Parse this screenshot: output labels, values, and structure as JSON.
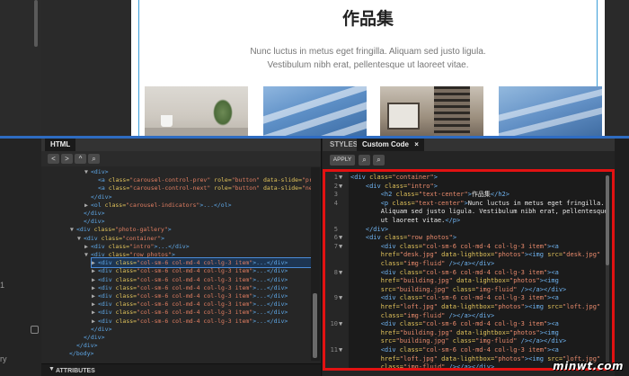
{
  "preview": {
    "title": "作品集",
    "intro_line1": "Nunc luctus in metus eget fringilla. Aliquam sed justo ligula.",
    "intro_line2": "Vestibulum nibh erat, pellentesque ut laoreet vitae."
  },
  "gutter": {
    "tick1": "1",
    "tick2": "ry"
  },
  "html_panel": {
    "tab": "HTML",
    "toolbar": [
      "<",
      ">",
      "^",
      "search-icon"
    ],
    "tree": [
      {
        "indent": 1,
        "tri": "▼",
        "parts": [
          [
            "tag",
            "<div>"
          ]
        ]
      },
      {
        "indent": 2,
        "tri": "",
        "parts": [
          [
            "tag",
            "<a "
          ],
          [
            "attr",
            "class="
          ],
          [
            "str",
            "\"carousel-control-prev\""
          ],
          [
            "attr",
            " role="
          ],
          [
            "str",
            "\"button\""
          ],
          [
            "attr",
            " data-slide="
          ],
          [
            "str",
            "\"prev\""
          ],
          [
            "attr",
            " href="
          ],
          [
            "str",
            "\"#carouse"
          ]
        ]
      },
      {
        "indent": 2,
        "tri": "",
        "parts": [
          [
            "tag",
            "<a "
          ],
          [
            "attr",
            "class="
          ],
          [
            "str",
            "\"carousel-control-next\""
          ],
          [
            "attr",
            " role="
          ],
          [
            "str",
            "\"button\""
          ],
          [
            "attr",
            " data-slide="
          ],
          [
            "str",
            "\"next\""
          ],
          [
            "attr",
            " href="
          ],
          [
            "str",
            "\"#carouse"
          ]
        ]
      },
      {
        "indent": 1,
        "tri": "",
        "parts": [
          [
            "tag",
            "</div>"
          ]
        ]
      },
      {
        "indent": 1,
        "tri": "▶",
        "parts": [
          [
            "tag",
            "<ol "
          ],
          [
            "attr",
            "class="
          ],
          [
            "str",
            "\"carousel-indicators\""
          ],
          [
            "tag",
            ">...</ol>"
          ]
        ]
      },
      {
        "indent": 0,
        "tri": "",
        "parts": [
          [
            "tag",
            "</div>"
          ]
        ]
      },
      {
        "indent": 0,
        "tri": "",
        "parts": [
          [
            "tag",
            "</div>"
          ]
        ]
      },
      {
        "indent": -1,
        "tri": "▼",
        "parts": [
          [
            "tag",
            "<div "
          ],
          [
            "attr",
            "class="
          ],
          [
            "str",
            "\"photo-gallery\""
          ],
          [
            "tag",
            ">"
          ]
        ]
      },
      {
        "indent": 0,
        "tri": "▼",
        "parts": [
          [
            "tag",
            "<div "
          ],
          [
            "attr",
            "class="
          ],
          [
            "str",
            "\"container\""
          ],
          [
            "tag",
            ">"
          ]
        ]
      },
      {
        "indent": 1,
        "tri": "▶",
        "parts": [
          [
            "tag",
            "<div "
          ],
          [
            "attr",
            "class="
          ],
          [
            "str",
            "\"intro\""
          ],
          [
            "tag",
            ">...</div>"
          ]
        ]
      },
      {
        "indent": 1,
        "tri": "▼",
        "parts": [
          [
            "tag",
            "<div "
          ],
          [
            "attr",
            "class="
          ],
          [
            "str",
            "\"row photos\""
          ],
          [
            "tag",
            ">"
          ]
        ]
      },
      {
        "indent": 2,
        "tri": "▶",
        "sel": true,
        "parts": [
          [
            "tag",
            "<div "
          ],
          [
            "attr",
            "class="
          ],
          [
            "str",
            "\"col-sm-6 col-md-4 col-lg-3 item\""
          ],
          [
            "tag",
            ">...</div>"
          ]
        ]
      },
      {
        "indent": 2,
        "tri": "▶",
        "parts": [
          [
            "tag",
            "<div "
          ],
          [
            "attr",
            "class="
          ],
          [
            "str",
            "\"col-sm-6 col-md-4 col-lg-3 item\""
          ],
          [
            "tag",
            ">...</div>"
          ]
        ]
      },
      {
        "indent": 2,
        "tri": "▶",
        "parts": [
          [
            "tag",
            "<div "
          ],
          [
            "attr",
            "class="
          ],
          [
            "str",
            "\"col-sm-6 col-md-4 col-lg-3 item\""
          ],
          [
            "tag",
            ">...</div>"
          ]
        ]
      },
      {
        "indent": 2,
        "tri": "▶",
        "parts": [
          [
            "tag",
            "<div "
          ],
          [
            "attr",
            "class="
          ],
          [
            "str",
            "\"col-sm-6 col-md-4 col-lg-3 item\""
          ],
          [
            "tag",
            ">...</div>"
          ]
        ]
      },
      {
        "indent": 2,
        "tri": "▶",
        "parts": [
          [
            "tag",
            "<div "
          ],
          [
            "attr",
            "class="
          ],
          [
            "str",
            "\"col-sm-6 col-md-4 col-lg-3 item\""
          ],
          [
            "tag",
            ">...</div>"
          ]
        ]
      },
      {
        "indent": 2,
        "tri": "▶",
        "parts": [
          [
            "tag",
            "<div "
          ],
          [
            "attr",
            "class="
          ],
          [
            "str",
            "\"col-sm-6 col-md-4 col-lg-3 item\""
          ],
          [
            "tag",
            ">...</div>"
          ]
        ]
      },
      {
        "indent": 2,
        "tri": "▶",
        "parts": [
          [
            "tag",
            "<div "
          ],
          [
            "attr",
            "class="
          ],
          [
            "str",
            "\"col-sm-6 col-md-4 col-lg-3 item\""
          ],
          [
            "tag",
            ">...</div>"
          ]
        ]
      },
      {
        "indent": 2,
        "tri": "▶",
        "parts": [
          [
            "tag",
            "<div "
          ],
          [
            "attr",
            "class="
          ],
          [
            "str",
            "\"col-sm-6 col-md-4 col-lg-3 item\""
          ],
          [
            "tag",
            ">...</div>"
          ]
        ]
      },
      {
        "indent": 1,
        "tri": "",
        "parts": [
          [
            "tag",
            "</div>"
          ]
        ]
      },
      {
        "indent": 0,
        "tri": "",
        "parts": [
          [
            "tag",
            "</div>"
          ]
        ]
      },
      {
        "indent": -1,
        "tri": "",
        "parts": [
          [
            "tag",
            "</div>"
          ]
        ]
      },
      {
        "indent": -2,
        "tri": "",
        "parts": [
          [
            "tag",
            "</body>"
          ]
        ]
      }
    ],
    "attributes_label": "ATTRIBUTES"
  },
  "code_panel": {
    "tab_styles": "STYLES",
    "tab_custom": "Custom Code",
    "tab_close": "×",
    "apply_label": "APPLY",
    "lines": [
      {
        "n": "1",
        "ar": "▼",
        "parts": [
          [
            "tag",
            "<div "
          ],
          [
            "attr",
            "class="
          ],
          [
            "str",
            "\"container\""
          ],
          [
            "tag",
            ">"
          ]
        ]
      },
      {
        "n": "2",
        "ar": "▼",
        "parts": [
          [
            "",
            "    "
          ],
          [
            "tag",
            "<div "
          ],
          [
            "attr",
            "class="
          ],
          [
            "str",
            "\"intro\""
          ],
          [
            "tag",
            ">"
          ]
        ]
      },
      {
        "n": "3",
        "ar": "",
        "parts": [
          [
            "",
            "        "
          ],
          [
            "tag",
            "<h2 "
          ],
          [
            "attr",
            "class="
          ],
          [
            "str",
            "\"text-center\""
          ],
          [
            "tag",
            ">"
          ],
          [
            "",
            "作品集"
          ],
          [
            "tag",
            "</h2>"
          ]
        ]
      },
      {
        "n": "4",
        "ar": "",
        "parts": [
          [
            "",
            "        "
          ],
          [
            "tag",
            "<p "
          ],
          [
            "attr",
            "class="
          ],
          [
            "str",
            "\"text-center\""
          ],
          [
            "tag",
            ">"
          ],
          [
            "",
            "Nunc luctus in metus eget fringilla."
          ]
        ]
      },
      {
        "n": "",
        "ar": "",
        "parts": [
          [
            "",
            "        Aliquam sed justo ligula. Vestibulum nibh erat, pellentesque"
          ]
        ]
      },
      {
        "n": "",
        "ar": "",
        "parts": [
          [
            "",
            "        ut laoreet vitae."
          ],
          [
            "tag",
            "</p>"
          ]
        ]
      },
      {
        "n": "5",
        "ar": "",
        "parts": [
          [
            "",
            "    "
          ],
          [
            "tag",
            "</div>"
          ]
        ]
      },
      {
        "n": "6",
        "ar": "▼",
        "parts": [
          [
            "",
            "    "
          ],
          [
            "tag",
            "<div "
          ],
          [
            "attr",
            "class="
          ],
          [
            "str",
            "\"row photos\""
          ],
          [
            "tag",
            ">"
          ]
        ]
      },
      {
        "n": "7",
        "ar": "▼",
        "parts": [
          [
            "",
            "        "
          ],
          [
            "tag",
            "<div "
          ],
          [
            "attr",
            "class="
          ],
          [
            "str",
            "\"col-sm-6 col-md-4 col-lg-3 item\""
          ],
          [
            "tag",
            "><a"
          ]
        ]
      },
      {
        "n": "",
        "ar": "",
        "parts": [
          [
            "",
            "        "
          ],
          [
            "attr",
            "href="
          ],
          [
            "str",
            "\"desk.jpg\""
          ],
          [
            "attr",
            " data-lightbox="
          ],
          [
            "str",
            "\"photos\""
          ],
          [
            "tag",
            "><img "
          ],
          [
            "attr",
            "src="
          ],
          [
            "str",
            "\"desk.jpg\""
          ]
        ]
      },
      {
        "n": "",
        "ar": "",
        "parts": [
          [
            "",
            "        "
          ],
          [
            "attr",
            "class="
          ],
          [
            "str",
            "\"img-fluid\""
          ],
          [
            "tag",
            " /></a></div>"
          ]
        ]
      },
      {
        "n": "8",
        "ar": "▼",
        "parts": [
          [
            "",
            "        "
          ],
          [
            "tag",
            "<div "
          ],
          [
            "attr",
            "class="
          ],
          [
            "str",
            "\"col-sm-6 col-md-4 col-lg-3 item\""
          ],
          [
            "tag",
            "><a"
          ]
        ]
      },
      {
        "n": "",
        "ar": "",
        "parts": [
          [
            "",
            "        "
          ],
          [
            "attr",
            "href="
          ],
          [
            "str",
            "\"building.jpg\""
          ],
          [
            "attr",
            " data-lightbox="
          ],
          [
            "str",
            "\"photos\""
          ],
          [
            "tag",
            "><img"
          ]
        ]
      },
      {
        "n": "",
        "ar": "",
        "parts": [
          [
            "",
            "        "
          ],
          [
            "attr",
            "src="
          ],
          [
            "str",
            "\"building.jpg\""
          ],
          [
            "attr",
            " class="
          ],
          [
            "str",
            "\"img-fluid\""
          ],
          [
            "tag",
            " /></a></div>"
          ]
        ]
      },
      {
        "n": "9",
        "ar": "▼",
        "parts": [
          [
            "",
            "        "
          ],
          [
            "tag",
            "<div "
          ],
          [
            "attr",
            "class="
          ],
          [
            "str",
            "\"col-sm-6 col-md-4 col-lg-3 item\""
          ],
          [
            "tag",
            "><a"
          ]
        ]
      },
      {
        "n": "",
        "ar": "",
        "parts": [
          [
            "",
            "        "
          ],
          [
            "attr",
            "href="
          ],
          [
            "str",
            "\"loft.jpg\""
          ],
          [
            "attr",
            " data-lightbox="
          ],
          [
            "str",
            "\"photos\""
          ],
          [
            "tag",
            "><img "
          ],
          [
            "attr",
            "src="
          ],
          [
            "str",
            "\"loft.jpg\""
          ]
        ]
      },
      {
        "n": "",
        "ar": "",
        "parts": [
          [
            "",
            "        "
          ],
          [
            "attr",
            "class="
          ],
          [
            "str",
            "\"img-fluid\""
          ],
          [
            "tag",
            " /></a></div>"
          ]
        ]
      },
      {
        "n": "10",
        "ar": "▼",
        "parts": [
          [
            "",
            "        "
          ],
          [
            "tag",
            "<div "
          ],
          [
            "attr",
            "class="
          ],
          [
            "str",
            "\"col-sm-6 col-md-4 col-lg-3 item\""
          ],
          [
            "tag",
            "><a"
          ]
        ]
      },
      {
        "n": "",
        "ar": "",
        "parts": [
          [
            "",
            "        "
          ],
          [
            "attr",
            "href="
          ],
          [
            "str",
            "\"building.jpg\""
          ],
          [
            "attr",
            " data-lightbox="
          ],
          [
            "str",
            "\"photos\""
          ],
          [
            "tag",
            "><img"
          ]
        ]
      },
      {
        "n": "",
        "ar": "",
        "parts": [
          [
            "",
            "        "
          ],
          [
            "attr",
            "src="
          ],
          [
            "str",
            "\"building.jpg\""
          ],
          [
            "attr",
            " class="
          ],
          [
            "str",
            "\"img-fluid\""
          ],
          [
            "tag",
            " /></a></div>"
          ]
        ]
      },
      {
        "n": "11",
        "ar": "▼",
        "parts": [
          [
            "",
            "        "
          ],
          [
            "tag",
            "<div "
          ],
          [
            "attr",
            "class="
          ],
          [
            "str",
            "\"col-sm-6 col-md-4 col-lg-3 item\""
          ],
          [
            "tag",
            "><a"
          ]
        ]
      },
      {
        "n": "",
        "ar": "",
        "parts": [
          [
            "",
            "        "
          ],
          [
            "attr",
            "href="
          ],
          [
            "str",
            "\"loft.jpg\""
          ],
          [
            "attr",
            " data-lightbox="
          ],
          [
            "str",
            "\"photos\""
          ],
          [
            "tag",
            "><img "
          ],
          [
            "attr",
            "src="
          ],
          [
            "str",
            "\"loft.jpg\""
          ]
        ]
      },
      {
        "n": "",
        "ar": "",
        "parts": [
          [
            "",
            "        "
          ],
          [
            "attr",
            "class="
          ],
          [
            "str",
            "\"img-fluid\""
          ],
          [
            "tag",
            " /></a></div>"
          ]
        ]
      }
    ]
  },
  "watermark": "minwt.com",
  "colors": {
    "accent": "#2e6cc2",
    "highlight_border": "#e21212",
    "tag": "#6fb3f0",
    "attr": "#e2c35b",
    "string": "#e88a6c"
  }
}
